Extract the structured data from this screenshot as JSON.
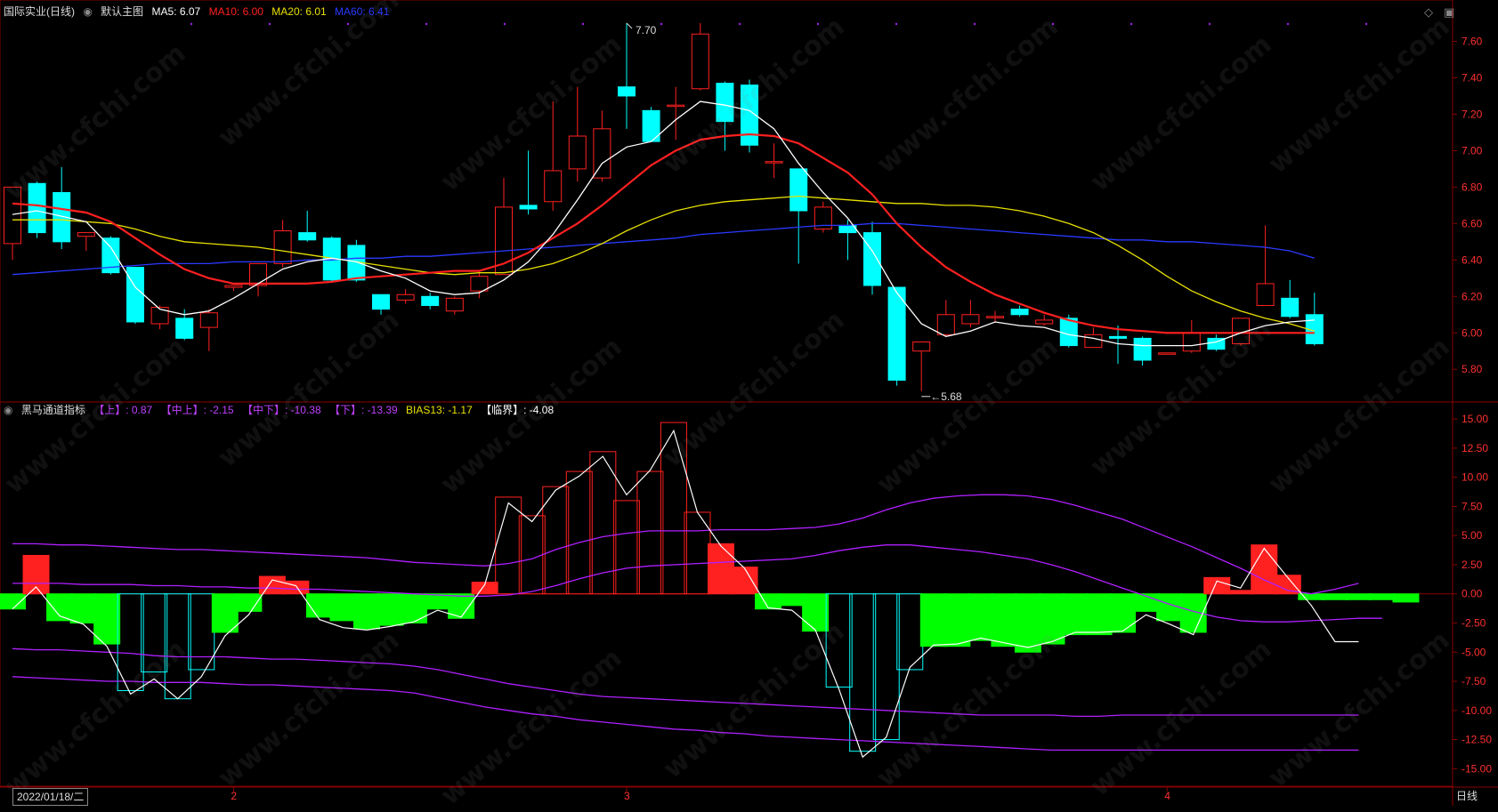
{
  "main_header": {
    "stock": "国际实业(日线)",
    "template": "默认主图",
    "ma5": "MA5: 6.07",
    "ma10": "MA10: 6.00",
    "ma20": "MA20: 6.01",
    "ma60": "MA60: 6.41"
  },
  "sub_header": {
    "indicator": "黑马通道指标",
    "upper": "【上】: 0.87",
    "mid_upper": "【中上】: -2.15",
    "mid_lower": "【中下】: -10.38",
    "lower": "【下】: -13.39",
    "bias": "BIAS13: -1.17",
    "critical": "【临界】: -4.08"
  },
  "annotations": {
    "high": "7.70",
    "low": "5.68"
  },
  "bottom": {
    "date": "2022/01/18/二",
    "period": "日线"
  },
  "month_markers": [
    "2",
    "3",
    "4"
  ],
  "watermark": "www.cfchi.com",
  "colors": {
    "up": "#ff2020",
    "down": "#00ffff",
    "ma5": "#ffffff",
    "ma10": "#ff2020",
    "ma20": "#e8e000",
    "ma60": "#2a3aff",
    "purple": "#b020ff",
    "green": "#00ff00"
  },
  "chart_data": [
    {
      "type": "candlestick",
      "title": "国际实业(日线)",
      "y_ticks": [
        "7.60",
        "7.40",
        "7.20",
        "7.00",
        "6.80",
        "6.60",
        "6.40",
        "6.20",
        "6.00",
        "5.80"
      ],
      "ylim": [
        5.64,
        7.7
      ],
      "candles": [
        [
          6.49,
          6.8,
          6.4,
          6.65
        ],
        [
          6.82,
          6.55,
          6.52,
          6.83
        ],
        [
          6.77,
          6.5,
          6.46,
          6.91
        ],
        [
          6.53,
          6.55,
          6.45,
          6.55
        ],
        [
          6.52,
          6.33,
          6.32,
          6.53
        ],
        [
          6.36,
          6.06,
          6.05,
          6.36
        ],
        [
          6.05,
          6.14,
          6.02,
          6.15
        ],
        [
          6.08,
          5.97,
          5.96,
          6.13
        ],
        [
          6.03,
          6.11,
          5.9,
          6.13
        ],
        [
          6.25,
          6.26,
          6.23,
          6.26
        ],
        [
          6.26,
          6.38,
          6.2,
          6.38
        ],
        [
          6.38,
          6.56,
          6.36,
          6.62
        ],
        [
          6.55,
          6.51,
          6.5,
          6.67
        ],
        [
          6.52,
          6.29,
          6.28,
          6.53
        ],
        [
          6.48,
          6.29,
          6.28,
          6.51
        ],
        [
          6.21,
          6.13,
          6.1,
          6.21
        ],
        [
          6.18,
          6.21,
          6.16,
          6.24
        ],
        [
          6.2,
          6.15,
          6.13,
          6.22
        ],
        [
          6.12,
          6.19,
          6.1,
          6.2
        ],
        [
          6.23,
          6.31,
          6.19,
          6.34
        ],
        [
          6.32,
          6.69,
          6.32,
          6.85
        ],
        [
          6.7,
          6.68,
          6.65,
          7.0
        ],
        [
          6.72,
          6.89,
          6.67,
          7.27
        ],
        [
          6.9,
          7.08,
          6.83,
          7.35
        ],
        [
          6.85,
          7.12,
          6.83,
          7.22
        ],
        [
          7.35,
          7.3,
          7.12,
          7.7
        ],
        [
          7.22,
          7.05,
          7.05,
          7.24
        ],
        [
          7.25,
          7.25,
          7.06,
          7.35
        ],
        [
          7.34,
          7.64,
          7.33,
          7.7
        ],
        [
          7.37,
          7.16,
          7.0,
          7.38
        ],
        [
          7.36,
          7.03,
          6.99,
          7.39
        ],
        [
          6.94,
          6.94,
          6.85,
          7.04
        ],
        [
          6.9,
          6.67,
          6.38,
          6.9
        ],
        [
          6.57,
          6.69,
          6.55,
          6.72
        ],
        [
          6.59,
          6.55,
          6.4,
          6.62
        ],
        [
          6.55,
          6.26,
          6.21,
          6.61
        ],
        [
          6.25,
          5.74,
          5.71,
          6.25
        ],
        [
          5.9,
          5.95,
          5.68,
          5.95
        ],
        [
          5.99,
          6.1,
          5.98,
          6.18
        ],
        [
          6.05,
          6.1,
          6.03,
          6.18
        ],
        [
          6.09,
          6.09,
          6.06,
          6.12
        ],
        [
          6.13,
          6.1,
          6.09,
          6.15
        ],
        [
          6.05,
          6.07,
          6.04,
          6.1
        ],
        [
          6.08,
          5.93,
          5.92,
          6.1
        ],
        [
          5.92,
          5.99,
          5.92,
          6.03
        ],
        [
          5.98,
          5.97,
          5.83,
          6.04
        ],
        [
          5.97,
          5.85,
          5.82,
          5.98
        ],
        [
          5.89,
          5.89,
          5.88,
          5.89
        ],
        [
          5.9,
          6.0,
          5.89,
          6.07
        ],
        [
          5.97,
          5.91,
          5.9,
          5.99
        ],
        [
          5.94,
          6.08,
          5.93,
          6.08
        ],
        [
          6.15,
          6.27,
          6.15,
          6.59
        ],
        [
          6.19,
          6.09,
          6.08,
          6.29
        ],
        [
          6.1,
          5.94,
          5.93,
          6.22
        ]
      ],
      "ma5": [
        6.65,
        6.67,
        6.64,
        6.61,
        6.47,
        6.25,
        6.13,
        6.1,
        6.12,
        6.19,
        6.27,
        6.35,
        6.39,
        6.41,
        6.39,
        6.34,
        6.3,
        6.23,
        6.21,
        6.22,
        6.29,
        6.39,
        6.54,
        6.73,
        6.93,
        7.02,
        7.05,
        7.17,
        7.27,
        7.25,
        7.22,
        7.12,
        6.93,
        6.77,
        6.63,
        6.45,
        6.22,
        6.05,
        5.98,
        6.01,
        6.06,
        6.04,
        6.03,
        5.99,
        5.97,
        5.94,
        5.93,
        5.93,
        5.93,
        5.95,
        6.0,
        6.04,
        6.06,
        6.07
      ],
      "ma10": [
        6.71,
        6.7,
        6.68,
        6.66,
        6.61,
        6.52,
        6.43,
        6.35,
        6.3,
        6.27,
        6.27,
        6.27,
        6.27,
        6.28,
        6.3,
        6.31,
        6.32,
        6.33,
        6.34,
        6.34,
        6.38,
        6.44,
        6.52,
        6.6,
        6.7,
        6.81,
        6.92,
        7.0,
        7.06,
        7.08,
        7.09,
        7.08,
        7.04,
        6.96,
        6.88,
        6.76,
        6.6,
        6.47,
        6.36,
        6.28,
        6.21,
        6.16,
        6.11,
        6.07,
        6.04,
        6.02,
        6.01,
        6.0,
        6.0,
        6.0,
        6.0,
        6.0,
        6.0,
        6.0
      ],
      "ma20": [
        6.62,
        6.62,
        6.62,
        6.61,
        6.6,
        6.57,
        6.53,
        6.5,
        6.49,
        6.48,
        6.47,
        6.45,
        6.43,
        6.41,
        6.39,
        6.37,
        6.35,
        6.33,
        6.32,
        6.33,
        6.33,
        6.35,
        6.38,
        6.43,
        6.49,
        6.56,
        6.62,
        6.67,
        6.7,
        6.72,
        6.73,
        6.74,
        6.75,
        6.74,
        6.73,
        6.72,
        6.71,
        6.71,
        6.7,
        6.7,
        6.69,
        6.67,
        6.64,
        6.6,
        6.55,
        6.48,
        6.4,
        6.31,
        6.23,
        6.17,
        6.12,
        6.08,
        6.05,
        6.01
      ],
      "ma60": [
        6.32,
        6.33,
        6.34,
        6.35,
        6.36,
        6.37,
        6.38,
        6.38,
        6.38,
        6.39,
        6.39,
        6.39,
        6.4,
        6.4,
        6.41,
        6.41,
        6.42,
        6.42,
        6.43,
        6.44,
        6.45,
        6.46,
        6.47,
        6.48,
        6.49,
        6.5,
        6.51,
        6.52,
        6.54,
        6.55,
        6.56,
        6.57,
        6.58,
        6.59,
        6.59,
        6.6,
        6.6,
        6.59,
        6.58,
        6.57,
        6.56,
        6.55,
        6.54,
        6.53,
        6.52,
        6.51,
        6.51,
        6.5,
        6.5,
        6.49,
        6.48,
        6.47,
        6.45,
        6.41
      ]
    },
    {
      "type": "bar",
      "title": "黑马通道指标",
      "y_ticks": [
        "15.00",
        "12.50",
        "10.00",
        "7.50",
        "5.00",
        "2.50",
        "0.00",
        "-2.50",
        "-5.00",
        "-7.50",
        "-10.00",
        "-12.50",
        "-15.00"
      ],
      "ylim": [
        -16.5,
        16.0
      ],
      "bars": [
        -1.3,
        3.3,
        -2.3,
        -2.5,
        -4.3,
        -8.3,
        -6.7,
        -9.0,
        -6.5,
        -3.3,
        -1.5,
        1.5,
        1.1,
        -2.0,
        -2.3,
        -3.0,
        -2.7,
        -2.5,
        -1.3,
        -2.1,
        1.0,
        8.3,
        6.7,
        9.2,
        10.5,
        12.2,
        8.0,
        10.5,
        14.7,
        7.0,
        4.3,
        2.3,
        -1.3,
        -1.0,
        -3.2,
        -8.0,
        -13.5,
        -12.5,
        -6.5,
        -4.5,
        -4.5,
        -4.0,
        -4.5,
        -5.0,
        -4.3,
        -3.5,
        -3.5,
        -3.3,
        -1.5,
        -2.3,
        -3.3,
        1.4,
        0.3,
        4.2,
        1.6,
        -0.5,
        -0.5,
        -0.5,
        -0.5,
        -0.7
      ],
      "bias13": [
        -1.3,
        0.6,
        -1.9,
        -2.6,
        -4.5,
        -8.6,
        -7.3,
        -9.0,
        -7.1,
        -3.6,
        -1.8,
        1.2,
        0.7,
        -2.2,
        -2.9,
        -3.1,
        -2.8,
        -2.4,
        -1.4,
        -2.0,
        0.8,
        7.8,
        6.2,
        8.9,
        10.1,
        11.8,
        8.5,
        10.6,
        14.0,
        7.0,
        4.1,
        2.2,
        -1.2,
        -1.4,
        -3.1,
        -8.2,
        -14.0,
        -12.3,
        -6.3,
        -4.4,
        -4.3,
        -3.8,
        -4.2,
        -4.6,
        -4.1,
        -3.3,
        -3.3,
        -3.2,
        -1.8,
        -2.6,
        -3.5,
        1.1,
        0.5,
        3.9,
        1.4,
        -1.0,
        -4.1,
        -4.1
      ],
      "upper": [
        4.3,
        4.3,
        4.2,
        4.2,
        4.1,
        4.0,
        3.9,
        3.8,
        3.8,
        3.7,
        3.6,
        3.5,
        3.4,
        3.3,
        3.2,
        3.1,
        2.9,
        2.7,
        2.6,
        2.5,
        2.4,
        2.6,
        3.0,
        3.8,
        4.4,
        4.9,
        5.2,
        5.4,
        5.4,
        5.4,
        5.5,
        5.5,
        5.5,
        5.6,
        5.7,
        6.0,
        6.5,
        7.2,
        7.8,
        8.2,
        8.4,
        8.5,
        8.5,
        8.4,
        8.1,
        7.6,
        7.0,
        6.4,
        5.6,
        4.8,
        4.0,
        3.1,
        2.2,
        1.2,
        0.3,
        0.0,
        0.4,
        0.9
      ],
      "mid_upper": [
        0.9,
        0.9,
        0.9,
        0.8,
        0.8,
        0.8,
        0.7,
        0.7,
        0.6,
        0.6,
        0.5,
        0.5,
        0.4,
        0.4,
        0.3,
        0.2,
        0.1,
        0.0,
        -0.1,
        -0.2,
        -0.2,
        -0.1,
        0.2,
        0.7,
        1.3,
        1.8,
        2.2,
        2.4,
        2.5,
        2.6,
        2.7,
        2.8,
        2.9,
        3.0,
        3.3,
        3.7,
        4.0,
        4.2,
        4.2,
        4.0,
        3.8,
        3.6,
        3.3,
        3.0,
        2.5,
        1.9,
        1.2,
        0.5,
        -0.2,
        -0.9,
        -1.5,
        -2.0,
        -2.3,
        -2.4,
        -2.4,
        -2.3,
        -2.2,
        -2.1,
        -2.1
      ],
      "mid_lower": [
        -4.7,
        -4.8,
        -4.8,
        -4.9,
        -5.0,
        -5.1,
        -5.3,
        -5.4,
        -5.4,
        -5.4,
        -5.5,
        -5.6,
        -5.6,
        -5.7,
        -5.8,
        -5.9,
        -6.0,
        -6.2,
        -6.5,
        -6.9,
        -7.3,
        -7.7,
        -8.0,
        -8.3,
        -8.6,
        -8.8,
        -8.9,
        -9.0,
        -9.1,
        -9.2,
        -9.3,
        -9.4,
        -9.5,
        -9.6,
        -9.7,
        -9.8,
        -9.9,
        -10.0,
        -10.1,
        -10.2,
        -10.3,
        -10.4,
        -10.4,
        -10.4,
        -10.4,
        -10.5,
        -10.5,
        -10.4,
        -10.4,
        -10.4,
        -10.4,
        -10.4,
        -10.4,
        -10.4,
        -10.4,
        -10.4,
        -10.4,
        -10.4
      ],
      "lower": [
        -7.1,
        -7.2,
        -7.3,
        -7.4,
        -7.5,
        -7.5,
        -7.6,
        -7.6,
        -7.6,
        -7.7,
        -7.8,
        -7.8,
        -7.9,
        -8.0,
        -8.1,
        -8.2,
        -8.3,
        -8.5,
        -8.9,
        -9.3,
        -9.7,
        -10.0,
        -10.3,
        -10.5,
        -10.8,
        -11.0,
        -11.2,
        -11.4,
        -11.6,
        -11.7,
        -11.9,
        -12.0,
        -12.2,
        -12.3,
        -12.4,
        -12.5,
        -12.6,
        -12.7,
        -12.8,
        -12.9,
        -13.0,
        -13.1,
        -13.2,
        -13.3,
        -13.4,
        -13.4,
        -13.4,
        -13.4,
        -13.4,
        -13.4,
        -13.4,
        -13.4,
        -13.4,
        -13.4,
        -13.4,
        -13.4,
        -13.4,
        -13.4
      ]
    }
  ]
}
